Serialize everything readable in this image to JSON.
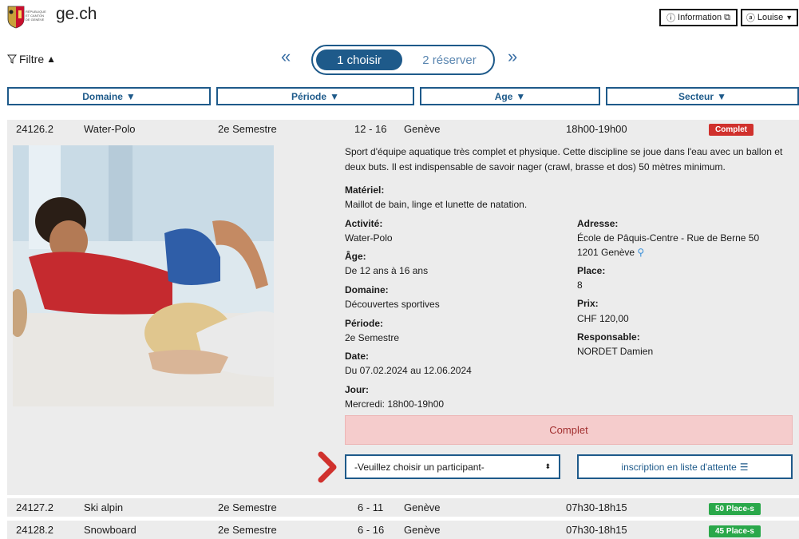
{
  "header": {
    "crest_text": "RÉPUBLIQUE ET CANTON DE GENÈVE",
    "brand": "ge.ch",
    "info_button": "Information",
    "user_button": "Louise",
    "info_icon": "info-circle-icon",
    "user_icon": "user-circle-icon"
  },
  "filters": {
    "toggle_label": "Filtre",
    "steps": [
      {
        "label": "1 choisir"
      },
      {
        "label": "2 réserver"
      }
    ],
    "domaine": "Domaine",
    "periode": "Période",
    "age": "Age",
    "secteur": "Secteur"
  },
  "selected": {
    "code": "24126.2",
    "name": "Water-Polo",
    "period": "2e Semestre",
    "ages": "12 - 16",
    "city": "Genève",
    "hours": "18h00-19h00",
    "status": "Complet",
    "description": "Sport d'équipe aquatique très complet et physique. Cette discipline se joue dans l'eau avec un ballon et deux buts. Il est indispensable de savoir nager (crawl, brasse et dos) 50 mètres minimum.",
    "materiel_label": "Matériel:",
    "materiel": "Maillot de bain, linge et lunette de natation.",
    "activite_label": "Activité:",
    "activite": "Water-Polo",
    "age_label": "Âge:",
    "age": "De 12 ans à 16 ans",
    "domaine_label": "Domaine:",
    "domaine": "Découvertes sportives",
    "periode_label": "Période:",
    "periode": "2e Semestre",
    "date_label": "Date:",
    "date": "Du 07.02.2024 au 12.06.2024",
    "jour_label": "Jour:",
    "jour": "Mercredi: 18h00-19h00",
    "adresse_label": "Adresse:",
    "adresse_line1": "École de Pâquis-Centre - Rue de Berne 50",
    "adresse_line2": "1201 Genève",
    "place_label": "Place:",
    "place": "8",
    "prix_label": "Prix:",
    "prix": "CHF 120,00",
    "responsable_label": "Responsable:",
    "responsable": "NORDET Damien",
    "complet_bar": "Complet",
    "select_placeholder": "-Veuillez choisir un participant-",
    "waitlist_button": "inscription en liste d'attente"
  },
  "rows": [
    {
      "code": "24127.2",
      "name": "Ski alpin",
      "period": "2e Semestre",
      "ages": "6 - 11",
      "city": "Genève",
      "hours": "07h30-18h15",
      "badge": "50 Place-s"
    },
    {
      "code": "24128.2",
      "name": "Snowboard",
      "period": "2e Semestre",
      "ages": "6 - 16",
      "city": "Genève",
      "hours": "07h30-18h15",
      "badge": "45 Place-s"
    }
  ],
  "colors": {
    "primary": "#1e5a8a",
    "status_full": "#d0312d",
    "status_available": "#2aa84a",
    "complet_bg": "#f5cccc",
    "arrow": "#d0312d"
  }
}
